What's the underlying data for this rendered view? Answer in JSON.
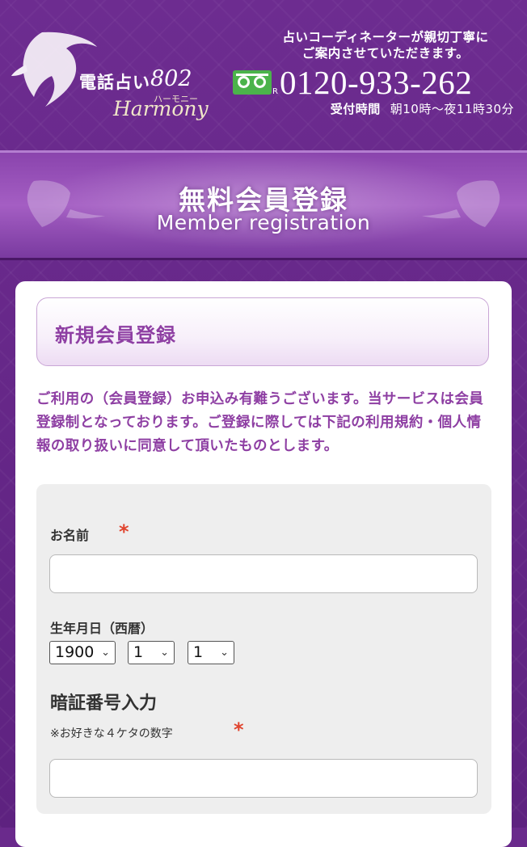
{
  "header": {
    "logo": {
      "jp": "電話占い",
      "num": "802",
      "kana": "ハーモニー",
      "en": "Harmony"
    },
    "message_line1": "占いコーディネーターが親切丁寧に",
    "message_line2": "ご案内させていただきます。",
    "phone_mark": "R",
    "phone": "0120-933-262",
    "hours_label": "受付時間",
    "hours_value": "朝10時〜夜11時30分"
  },
  "banner": {
    "title_jp": "無料会員登録",
    "title_en": "Member registration"
  },
  "section": {
    "title": "新規会員登録",
    "intro": "ご利用の（会員登録）お申込み有難うございます。当サービスは会員登録制となっております。ご登録に際しては下記の利用規約・個人情報の取り扱いに同意して頂いたものとします。"
  },
  "form": {
    "name_label": "お名前",
    "required_mark": "*",
    "name_value": "",
    "birthday_label": "生年月日（西暦）",
    "year": "1900",
    "month": "1",
    "day": "1",
    "pin_title": "暗証番号入力",
    "pin_note": "※お好きな４ケタの数字",
    "pin_value": ""
  },
  "colors": {
    "bg": "#6a2a8c",
    "accent_text": "#8e3fa3",
    "required": "#e0442e",
    "freedial": "#4bb34b"
  },
  "icons": {
    "freedial": "freedial-icon",
    "logo": "woman-silhouette-logo",
    "select": "chevron-down-icon"
  }
}
